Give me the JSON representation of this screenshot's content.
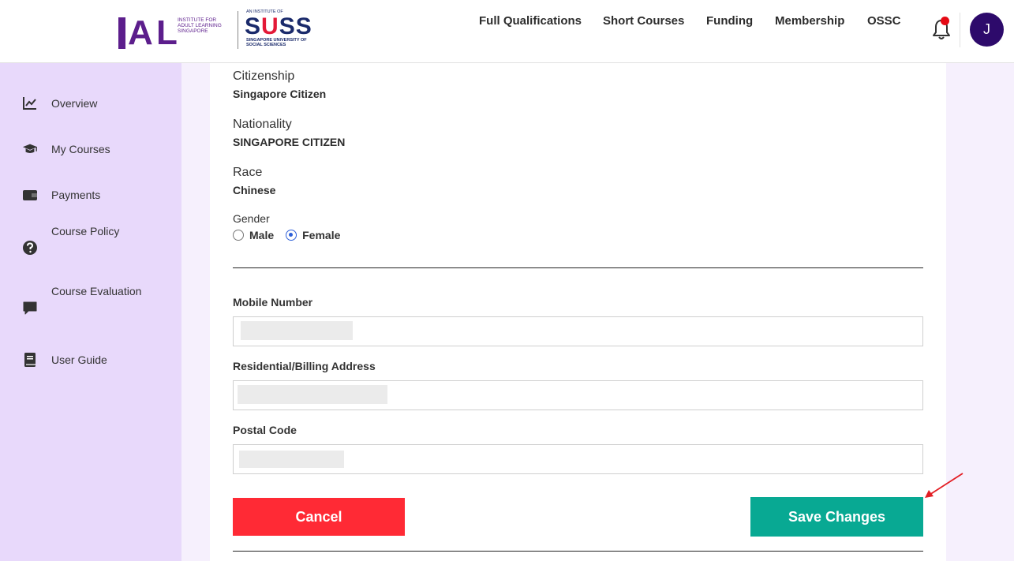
{
  "header": {
    "logo": {
      "ial_text": "INSTITUTE FOR ADULT LEARNING SINGAPORE",
      "suss_top": "AN INSTITUTE OF",
      "suss_word_1": "S",
      "suss_word_2": "U",
      "suss_word_3": "SS",
      "suss_sub": "SINGAPORE UNIVERSITY OF SOCIAL SCIENCES"
    },
    "nav": [
      "Full Qualifications",
      "Short Courses",
      "Funding",
      "Membership",
      "OSSC"
    ],
    "avatar_initial": "J",
    "icons": {
      "bell": "bell-icon"
    }
  },
  "sidebar": {
    "items": [
      {
        "label": "Overview",
        "icon": "chart-line-icon"
      },
      {
        "label": "My Courses",
        "icon": "graduation-cap-icon"
      },
      {
        "label": "Payments",
        "icon": "wallet-icon"
      },
      {
        "label": "Course Policy",
        "icon": "question-circle-icon"
      },
      {
        "label": "Course Evaluation",
        "icon": "comment-icon"
      },
      {
        "label": "User Guide",
        "icon": "book-icon"
      }
    ]
  },
  "profile": {
    "citizenship_label": "Citizenship",
    "citizenship_value": "Singapore Citizen",
    "nationality_label": "Nationality",
    "nationality_value": "SINGAPORE CITIZEN",
    "race_label": "Race",
    "race_value": "Chinese",
    "gender_label": "Gender",
    "gender_options": [
      "Male",
      "Female"
    ],
    "gender_selected": "Female"
  },
  "form": {
    "mobile_label": "Mobile Number",
    "mobile_value": "",
    "address_label": "Residential/Billing Address",
    "address_value": "",
    "postal_label": "Postal Code",
    "postal_value": ""
  },
  "actions": {
    "cancel_label": "Cancel",
    "save_label": "Save Changes"
  },
  "colors": {
    "brand_purple": "#5c1e8c",
    "suss_navy": "#1a2a6b",
    "suss_red": "#e31937",
    "sidebar_bg": "#e8d9fb",
    "cancel_red": "#ff2a35",
    "save_teal": "#08a993",
    "avatar_bg": "#2d0a6b",
    "annotation_arrow": "#e31e24"
  }
}
